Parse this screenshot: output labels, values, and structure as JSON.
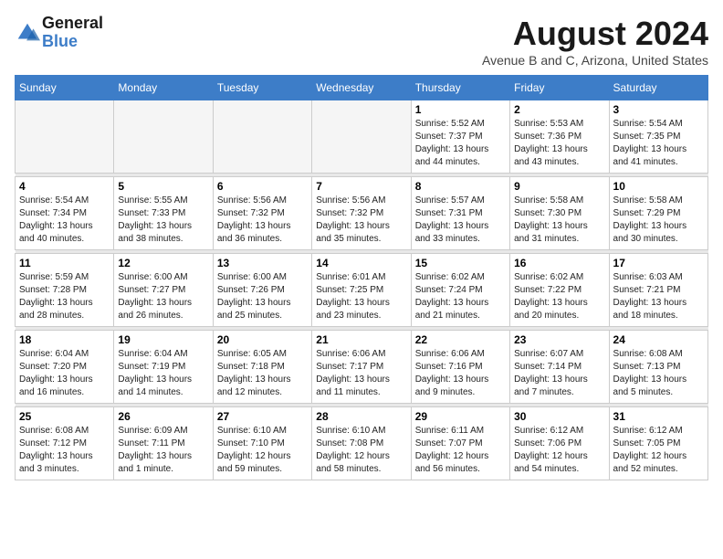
{
  "header": {
    "logo_line1": "General",
    "logo_line2": "Blue",
    "month_year": "August 2024",
    "location": "Avenue B and C, Arizona, United States"
  },
  "weekdays": [
    "Sunday",
    "Monday",
    "Tuesday",
    "Wednesday",
    "Thursday",
    "Friday",
    "Saturday"
  ],
  "weeks": [
    [
      {
        "day": "",
        "sunrise": "",
        "sunset": "",
        "daylight": "",
        "empty": true
      },
      {
        "day": "",
        "sunrise": "",
        "sunset": "",
        "daylight": "",
        "empty": true
      },
      {
        "day": "",
        "sunrise": "",
        "sunset": "",
        "daylight": "",
        "empty": true
      },
      {
        "day": "",
        "sunrise": "",
        "sunset": "",
        "daylight": "",
        "empty": true
      },
      {
        "day": "1",
        "sunrise": "Sunrise: 5:52 AM",
        "sunset": "Sunset: 7:37 PM",
        "daylight": "Daylight: 13 hours and 44 minutes."
      },
      {
        "day": "2",
        "sunrise": "Sunrise: 5:53 AM",
        "sunset": "Sunset: 7:36 PM",
        "daylight": "Daylight: 13 hours and 43 minutes."
      },
      {
        "day": "3",
        "sunrise": "Sunrise: 5:54 AM",
        "sunset": "Sunset: 7:35 PM",
        "daylight": "Daylight: 13 hours and 41 minutes."
      }
    ],
    [
      {
        "day": "4",
        "sunrise": "Sunrise: 5:54 AM",
        "sunset": "Sunset: 7:34 PM",
        "daylight": "Daylight: 13 hours and 40 minutes."
      },
      {
        "day": "5",
        "sunrise": "Sunrise: 5:55 AM",
        "sunset": "Sunset: 7:33 PM",
        "daylight": "Daylight: 13 hours and 38 minutes."
      },
      {
        "day": "6",
        "sunrise": "Sunrise: 5:56 AM",
        "sunset": "Sunset: 7:32 PM",
        "daylight": "Daylight: 13 hours and 36 minutes."
      },
      {
        "day": "7",
        "sunrise": "Sunrise: 5:56 AM",
        "sunset": "Sunset: 7:32 PM",
        "daylight": "Daylight: 13 hours and 35 minutes."
      },
      {
        "day": "8",
        "sunrise": "Sunrise: 5:57 AM",
        "sunset": "Sunset: 7:31 PM",
        "daylight": "Daylight: 13 hours and 33 minutes."
      },
      {
        "day": "9",
        "sunrise": "Sunrise: 5:58 AM",
        "sunset": "Sunset: 7:30 PM",
        "daylight": "Daylight: 13 hours and 31 minutes."
      },
      {
        "day": "10",
        "sunrise": "Sunrise: 5:58 AM",
        "sunset": "Sunset: 7:29 PM",
        "daylight": "Daylight: 13 hours and 30 minutes."
      }
    ],
    [
      {
        "day": "11",
        "sunrise": "Sunrise: 5:59 AM",
        "sunset": "Sunset: 7:28 PM",
        "daylight": "Daylight: 13 hours and 28 minutes."
      },
      {
        "day": "12",
        "sunrise": "Sunrise: 6:00 AM",
        "sunset": "Sunset: 7:27 PM",
        "daylight": "Daylight: 13 hours and 26 minutes."
      },
      {
        "day": "13",
        "sunrise": "Sunrise: 6:00 AM",
        "sunset": "Sunset: 7:26 PM",
        "daylight": "Daylight: 13 hours and 25 minutes."
      },
      {
        "day": "14",
        "sunrise": "Sunrise: 6:01 AM",
        "sunset": "Sunset: 7:25 PM",
        "daylight": "Daylight: 13 hours and 23 minutes."
      },
      {
        "day": "15",
        "sunrise": "Sunrise: 6:02 AM",
        "sunset": "Sunset: 7:24 PM",
        "daylight": "Daylight: 13 hours and 21 minutes."
      },
      {
        "day": "16",
        "sunrise": "Sunrise: 6:02 AM",
        "sunset": "Sunset: 7:22 PM",
        "daylight": "Daylight: 13 hours and 20 minutes."
      },
      {
        "day": "17",
        "sunrise": "Sunrise: 6:03 AM",
        "sunset": "Sunset: 7:21 PM",
        "daylight": "Daylight: 13 hours and 18 minutes."
      }
    ],
    [
      {
        "day": "18",
        "sunrise": "Sunrise: 6:04 AM",
        "sunset": "Sunset: 7:20 PM",
        "daylight": "Daylight: 13 hours and 16 minutes."
      },
      {
        "day": "19",
        "sunrise": "Sunrise: 6:04 AM",
        "sunset": "Sunset: 7:19 PM",
        "daylight": "Daylight: 13 hours and 14 minutes."
      },
      {
        "day": "20",
        "sunrise": "Sunrise: 6:05 AM",
        "sunset": "Sunset: 7:18 PM",
        "daylight": "Daylight: 13 hours and 12 minutes."
      },
      {
        "day": "21",
        "sunrise": "Sunrise: 6:06 AM",
        "sunset": "Sunset: 7:17 PM",
        "daylight": "Daylight: 13 hours and 11 minutes."
      },
      {
        "day": "22",
        "sunrise": "Sunrise: 6:06 AM",
        "sunset": "Sunset: 7:16 PM",
        "daylight": "Daylight: 13 hours and 9 minutes."
      },
      {
        "day": "23",
        "sunrise": "Sunrise: 6:07 AM",
        "sunset": "Sunset: 7:14 PM",
        "daylight": "Daylight: 13 hours and 7 minutes."
      },
      {
        "day": "24",
        "sunrise": "Sunrise: 6:08 AM",
        "sunset": "Sunset: 7:13 PM",
        "daylight": "Daylight: 13 hours and 5 minutes."
      }
    ],
    [
      {
        "day": "25",
        "sunrise": "Sunrise: 6:08 AM",
        "sunset": "Sunset: 7:12 PM",
        "daylight": "Daylight: 13 hours and 3 minutes."
      },
      {
        "day": "26",
        "sunrise": "Sunrise: 6:09 AM",
        "sunset": "Sunset: 7:11 PM",
        "daylight": "Daylight: 13 hours and 1 minute."
      },
      {
        "day": "27",
        "sunrise": "Sunrise: 6:10 AM",
        "sunset": "Sunset: 7:10 PM",
        "daylight": "Daylight: 12 hours and 59 minutes."
      },
      {
        "day": "28",
        "sunrise": "Sunrise: 6:10 AM",
        "sunset": "Sunset: 7:08 PM",
        "daylight": "Daylight: 12 hours and 58 minutes."
      },
      {
        "day": "29",
        "sunrise": "Sunrise: 6:11 AM",
        "sunset": "Sunset: 7:07 PM",
        "daylight": "Daylight: 12 hours and 56 minutes."
      },
      {
        "day": "30",
        "sunrise": "Sunrise: 6:12 AM",
        "sunset": "Sunset: 7:06 PM",
        "daylight": "Daylight: 12 hours and 54 minutes."
      },
      {
        "day": "31",
        "sunrise": "Sunrise: 6:12 AM",
        "sunset": "Sunset: 7:05 PM",
        "daylight": "Daylight: 12 hours and 52 minutes."
      }
    ]
  ]
}
